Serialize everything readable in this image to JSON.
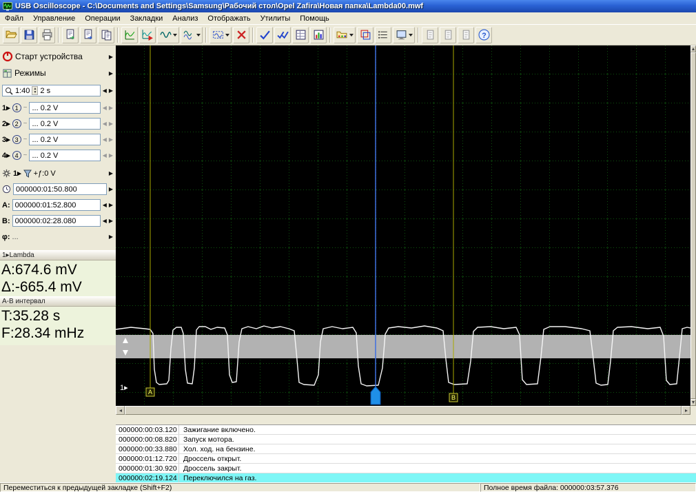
{
  "window": {
    "title": "USB Oscilloscope - C:\\Documents and Settings\\Samsung\\Рабочий стол\\Opel Zafira\\Новая папка\\Lambda00.mwf"
  },
  "menu": {
    "items": [
      "Файл",
      "Управление",
      "Операции",
      "Закладки",
      "Анализ",
      "Отображать",
      "Утилиты",
      "Помощь"
    ]
  },
  "toolbar": {
    "icons": [
      "open-file",
      "save-file",
      "print",
      "copy-image",
      "copy-data",
      "copy-frames",
      "scope-view",
      "scope-run",
      "signal-mode",
      "math-mode",
      "zoom-select",
      "delete-marks",
      "verify-one",
      "verify-two",
      "marks-grid",
      "marks-chart",
      "bookmarks-folder",
      "compare-signals",
      "signal-list",
      "export-view",
      "page-copy-1",
      "page-copy-2",
      "page-copy-3",
      "help"
    ]
  },
  "glyphs": {
    "arrow_right": "▶",
    "arrow_left": "◀",
    "spin_up": "▲",
    "spin_down": "▼",
    "probe": "~",
    "question": "?"
  },
  "sidebar": {
    "start_label": "Старт устройства",
    "modes_label": "Режимы",
    "zoom_scale": "1:40",
    "time_per_div": "2 s",
    "channels": [
      {
        "prefix": "1▸",
        "num": "1",
        "value": "... 0.2 V"
      },
      {
        "prefix": "2▸",
        "num": "2",
        "value": "... 0.2 V"
      },
      {
        "prefix": "3▸",
        "num": "3",
        "value": "... 0.2 V"
      },
      {
        "prefix": "4▸",
        "num": "4",
        "value": "... 0.2 V"
      }
    ],
    "trigger_row": {
      "prefix": "1▸",
      "value": "+ƒ:0 V"
    },
    "time_row": {
      "value": "000000:01:50.800"
    },
    "cursor_a": {
      "label": "A:",
      "value": "000000:01:52.800"
    },
    "cursor_b": {
      "label": "B:",
      "value": "000000:02:28.080"
    },
    "phase_row": {
      "label": "φ:",
      "value": "..."
    },
    "lambda_panel": {
      "header": "1▸Lambda",
      "line1": "A:674.6 mV",
      "line2": "Δ:-665.4 mV"
    },
    "interval_panel": {
      "header": "A-B интервал",
      "line1": "T:35.28 s",
      "line2": "F:28.34 mHz"
    }
  },
  "scope": {
    "channel_label": "1▸",
    "cursor_a": "A",
    "cursor_b": "B"
  },
  "events": [
    {
      "time": "000000:00:03.120",
      "text": "Зажигание включено."
    },
    {
      "time": "000000:00:08.820",
      "text": "Запуск мотора."
    },
    {
      "time": "000000:00:33.880",
      "text": "Хол. ход. на бензине."
    },
    {
      "time": "000000:01:12.720",
      "text": "Дроссель открыт."
    },
    {
      "time": "000000:01:30.920",
      "text": "Дроссель закрыт."
    },
    {
      "time": "000000:02:19.124",
      "text": "Переключился на газ."
    }
  ],
  "statusbar": {
    "left": "Переместиться к предыдущей закладке (Shift+F2)",
    "right": "Полное время файла: 000000:03:57.376"
  }
}
